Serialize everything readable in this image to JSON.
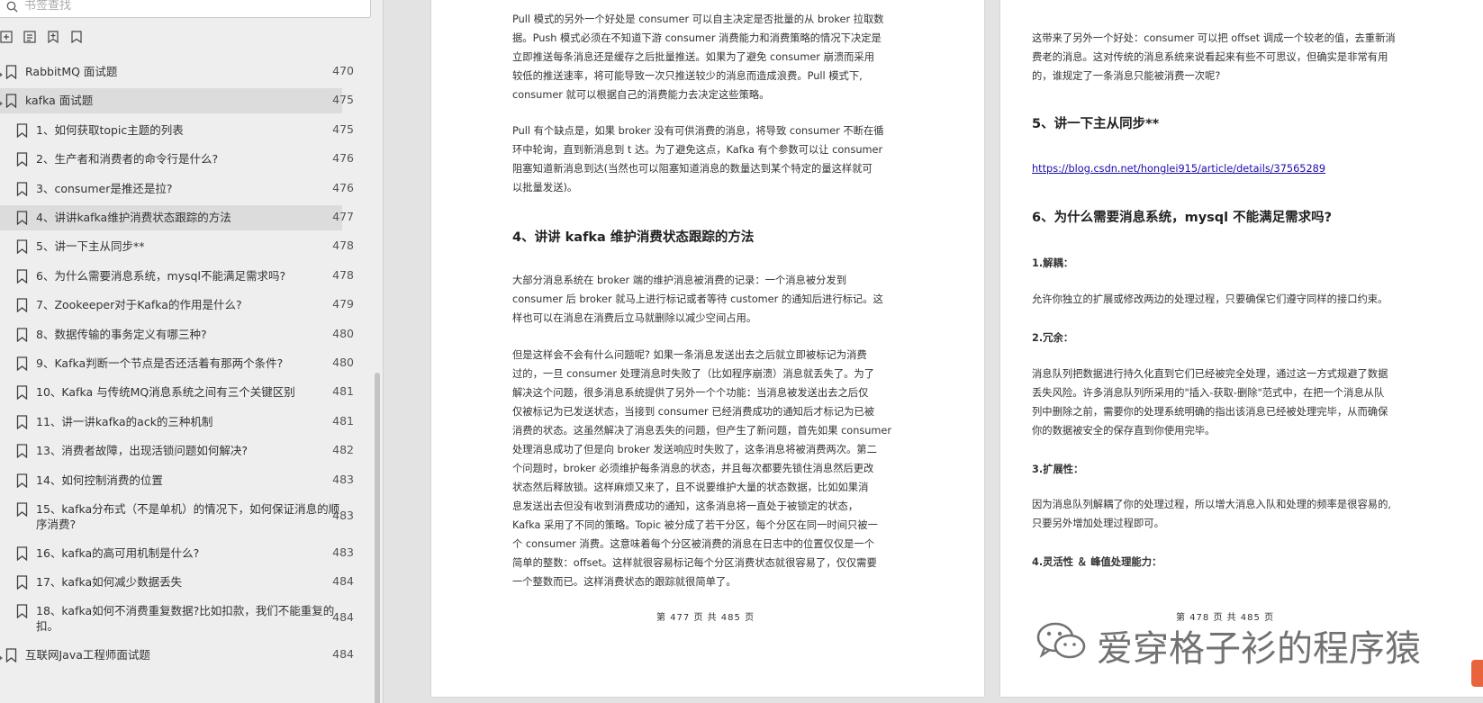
{
  "sidebar": {
    "search_placeholder": "书签查找",
    "toolbar": [
      "expand-all",
      "collapse-all",
      "add-bookmark",
      "bookmark"
    ],
    "items": [
      {
        "level": 0,
        "label": "RabbitMQ 面试题",
        "page": "470",
        "highlight": false
      },
      {
        "level": 0,
        "label": "kafka 面试题",
        "page": "475",
        "highlight": true
      },
      {
        "level": 1,
        "label": "1、如何获取topic主题的列表",
        "page": "475",
        "highlight": false
      },
      {
        "level": 1,
        "label": "2、生产者和消费者的命令行是什么?",
        "page": "476",
        "highlight": false
      },
      {
        "level": 1,
        "label": "3、consumer是推还是拉?",
        "page": "476",
        "highlight": false
      },
      {
        "level": 1,
        "label": "4、讲讲kafka维护消费状态跟踪的方法",
        "page": "477",
        "highlight": true
      },
      {
        "level": 1,
        "label": "5、讲一下主从同步**",
        "page": "478",
        "highlight": false
      },
      {
        "level": 1,
        "label": "6、为什么需要消息系统，mysql不能满足需求吗?",
        "page": "478",
        "highlight": false
      },
      {
        "level": 1,
        "label": "7、Zookeeper对于Kafka的作用是什么?",
        "page": "479",
        "highlight": false
      },
      {
        "level": 1,
        "label": "8、数据传输的事务定义有哪三种?",
        "page": "480",
        "highlight": false
      },
      {
        "level": 1,
        "label": "9、Kafka判断一个节点是否还活着有那两个条件?",
        "page": "480",
        "highlight": false
      },
      {
        "level": 1,
        "label": "10、Kafka 与传统MQ消息系统之间有三个关键区别",
        "page": "481",
        "highlight": false
      },
      {
        "level": 1,
        "label": "11、讲一讲kafka的ack的三种机制",
        "page": "481",
        "highlight": false
      },
      {
        "level": 1,
        "label": "13、消费者故障，出现活锁问题如何解决?",
        "page": "482",
        "highlight": false
      },
      {
        "level": 1,
        "label": "14、如何控制消费的位置",
        "page": "483",
        "highlight": false
      },
      {
        "level": 1,
        "label": "15、kafka分布式（不是单机）的情况下，如何保证消息的顺",
        "label2": "序消费?",
        "page": "483",
        "highlight": false
      },
      {
        "level": 1,
        "label": "16、kafka的高可用机制是什么?",
        "page": "483",
        "highlight": false
      },
      {
        "level": 1,
        "label": "17、kafka如何减少数据丢失",
        "page": "484",
        "highlight": false
      },
      {
        "level": 1,
        "label": "18、kafka如何不消费重复数据?比如扣款，我们不能重复的",
        "label2": "扣。",
        "page": "484",
        "highlight": false
      },
      {
        "level": 0,
        "label": "互联网Java工程师面试题",
        "page": "484",
        "highlight": false
      }
    ]
  },
  "left_page": {
    "para1": [
      "Pull 模式的另外一个好处是 consumer 可以自主决定是否批量的从 broker 拉取数",
      "据。Push 模式必须在不知道下游 consumer 消费能力和消费策略的情况下决定是",
      "立即推送每条消息还是缓存之后批量推送。如果为了避免 consumer 崩溃而采用",
      "较低的推送速率，将可能导致一次只推送较少的消息而造成浪费。Pull 模式下,",
      "consumer 就可以根据自己的消费能力去决定这些策略。"
    ],
    "para2": [
      "Pull 有个缺点是，如果 broker 没有可供消费的消息，将导致 consumer 不断在循",
      "环中轮询，直到新消息到 t 达。为了避免这点，Kafka 有个参数可以让 consumer",
      "阻塞知道新消息到达(当然也可以阻塞知道消息的数量达到某个特定的量这样就可",
      "以批量发送)。"
    ],
    "heading": "4、讲讲 kafka 维护消费状态跟踪的方法",
    "para3": [
      "大部分消息系统在 broker 端的维护消息被消费的记录：一个消息被分发到",
      "consumer 后 broker 就马上进行标记或者等待 customer 的通知后进行标记。这",
      "样也可以在消息在消费后立马就删除以减少空间占用。"
    ],
    "para4": [
      "但是这样会不会有什么问题呢? 如果一条消息发送出去之后就立即被标记为消费",
      "过的，一旦 consumer 处理消息时失败了（比如程序崩溃）消息就丢失了。为了",
      "解决这个问题，很多消息系统提供了另外一个个功能：当消息被发送出去之后仅",
      "仅被标记为已发送状态，当接到 consumer 已经消费成功的通知后才标记为已被",
      "消费的状态。这虽然解决了消息丢失的问题，但产生了新问题，首先如果 consumer",
      "处理消息成功了但是向 broker 发送响应时失败了，这条消息将被消费两次。第二",
      "个问题时，broker 必须维护每条消息的状态，并且每次都要先锁住消息然后更改",
      "状态然后释放锁。这样麻烦又来了，且不说要维护大量的状态数据，比如如果消",
      "息发送出去但没有收到消费成功的通知，这条消息将一直处于被锁定的状态，",
      "Kafka 采用了不同的策略。Topic 被分成了若干分区，每个分区在同一时间只被一",
      "个 consumer 消费。这意味着每个分区被消费的消息在日志中的位置仅仅是一个",
      "简单的整数：offset。这样就很容易标记每个分区消费状态就很容易了，仅仅需要",
      "一个整数而已。这样消费状态的跟踪就很简单了。"
    ],
    "footer": "第 477 页 共 485 页"
  },
  "right_page": {
    "para1": [
      "这带来了另外一个好处：consumer 可以把 offset 调成一个较老的值，去重新消",
      "费老的消息。这对传统的消息系统来说看起来有些不可思议，但确实是非常有用",
      "的，谁规定了一条消息只能被消费一次呢?"
    ],
    "heading5": "5、讲一下主从同步**",
    "link": "https://blog.csdn.net/honglei915/article/details/37565289",
    "heading6": "6、为什么需要消息系统，mysql 不能满足需求吗?",
    "s1": "1.解耦：",
    "s1p": [
      "允许你独立的扩展或修改两边的处理过程，只要确保它们遵守同样的接口约束。"
    ],
    "s2": "2.冗余：",
    "s2p": [
      "消息队列把数据进行持久化直到它们已经被完全处理，通过这一方式规避了数据",
      "丢失风险。许多消息队列所采用的\"插入-获取-删除\"范式中，在把一个消息从队",
      "列中删除之前，需要你的处理系统明确的指出该消息已经被处理完毕，从而确保",
      "你的数据被安全的保存直到你使用完毕。"
    ],
    "s3": "3.扩展性：",
    "s3p": [
      "因为消息队列解耦了你的处理过程，所以增大消息入队和处理的频率是很容易的,",
      "只要另外增加处理过程即可。"
    ],
    "s4": "4.灵活性 ＆ 峰值处理能力：",
    "footer": "第 478 页 共 485 页"
  },
  "watermark": "爱穿格子衫的程序猿",
  "colors": {
    "sidebar_bg": "#eeeeee",
    "highlight": "#dcdcdc",
    "link": "#1a0dab",
    "logo": "#e8643c"
  }
}
